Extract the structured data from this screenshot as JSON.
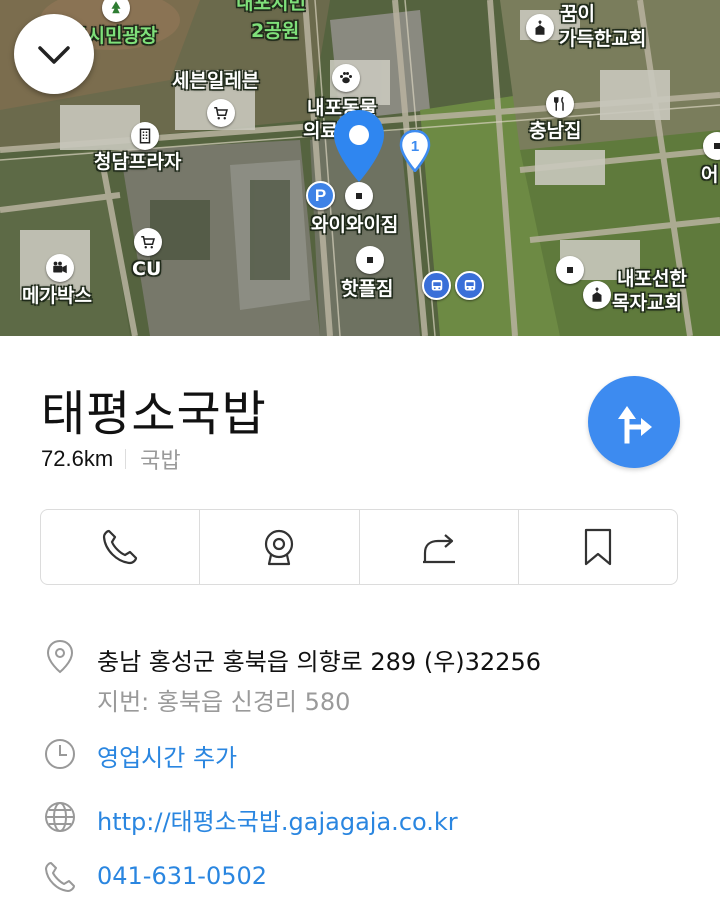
{
  "map": {
    "labels": {
      "top_center": "내포지민",
      "park": "2공원",
      "plaza": "도시민광장",
      "seven_eleven": "세븐일레븐",
      "pet": "내포동물",
      "pet2": "의료",
      "cheongdam": "청담프라자",
      "cu": "CU",
      "megabox": "메가박스",
      "waiwai": "와이와이짐",
      "hotple": "핫플짐",
      "dream1": "꿈이",
      "dream2": "가득한교회",
      "chungnam": "충남집",
      "edge": "어",
      "naepo1": "내포선한",
      "naepo2": "목자교회"
    },
    "marker_number": "1",
    "parking_letter": "P"
  },
  "place": {
    "name": "태평소국밥",
    "distance": "72.6km",
    "category": "국밥"
  },
  "address": {
    "road": "충남 홍성군 홍북읍 의향로 289 (우)32256",
    "lot": "지번: 홍북읍 신경리 580"
  },
  "hours_action": "영업시간 추가",
  "website": "http://태평소국밥.gajagaja.co.kr",
  "phone": "041-631-0502",
  "colors": {
    "accent": "#3d8bf0",
    "link": "#2a86e0"
  }
}
